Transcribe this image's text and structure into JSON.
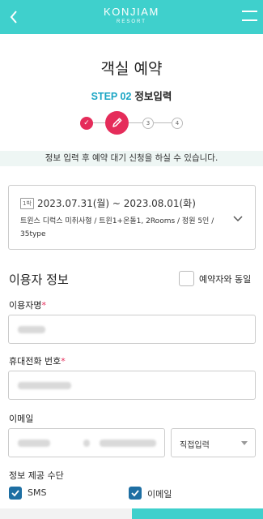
{
  "header": {
    "logo_main": "KONJIAM",
    "logo_sub": "RESORT",
    "back_icon": "chevron-left-icon",
    "menu_icon": "hamburger-menu-icon",
    "bg_color": "#3fd0cc"
  },
  "page": {
    "title": "객실 예약",
    "step_number": "STEP 02",
    "step_label": "정보입력"
  },
  "stepper": {
    "current_step": 2,
    "steps": [
      {
        "label": "✓",
        "state": "done"
      },
      {
        "label": "",
        "state": "active",
        "icon": "pencil-icon"
      },
      {
        "label": "3",
        "state": "pending"
      },
      {
        "label": "4",
        "state": "pending"
      }
    ],
    "accent_color": "#e52c5a"
  },
  "notice": "정보 입력 후 예약 대기 신청을 하실 수 있습니다.",
  "reservation": {
    "badge": "1박",
    "date_range": "2023.07.31(월) ~ 2023.08.01(화)",
    "desc_line1": "트윈스 디럭스 미취사형 / 트윈1+온돌1, 2Rooms / 정원 5인 /",
    "desc_line2": "35type"
  },
  "user_info": {
    "section_title": "이용자 정보",
    "same_as_reserver_label": "예약자와 동일",
    "same_as_reserver_checked": false,
    "name_label": "이용자명",
    "phone_label": "휴대전화 번호",
    "email_label": "이메일",
    "email_domain_select": "직접입력",
    "required_mark": "*"
  },
  "info_method": {
    "label": "정보 제공 수단",
    "options": [
      {
        "label": "SMS",
        "checked": true
      },
      {
        "label": "이메일",
        "checked": true
      }
    ]
  }
}
